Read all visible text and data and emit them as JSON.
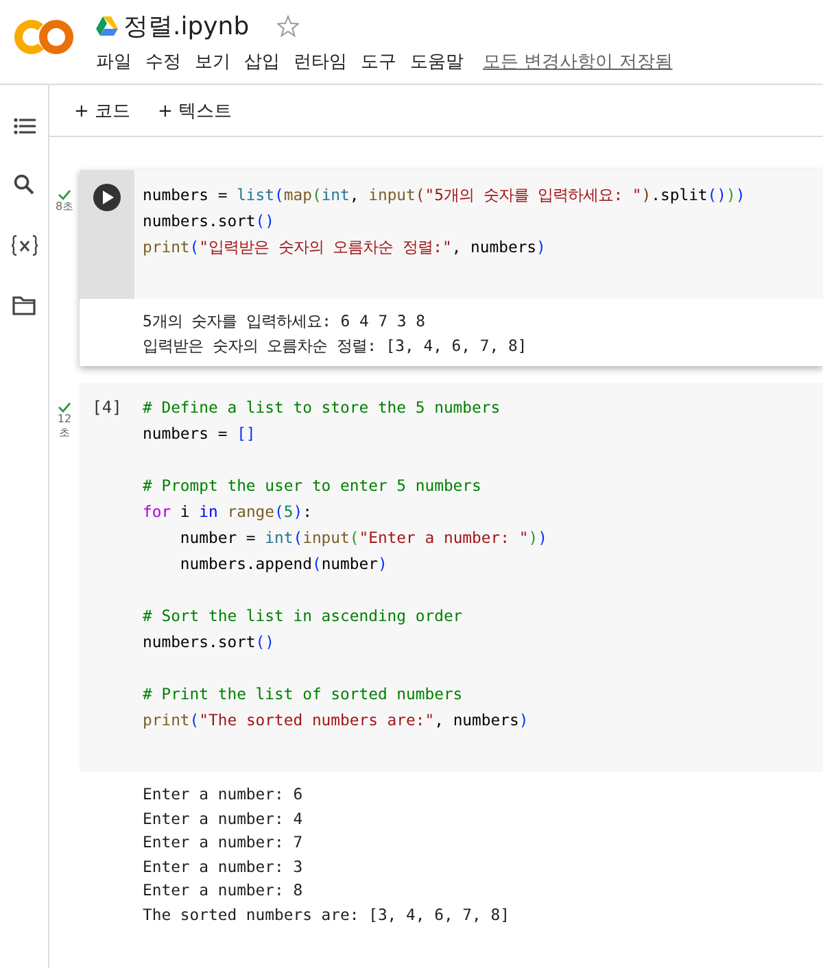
{
  "header": {
    "title": "정렬.ipynb",
    "menu": [
      "파일",
      "수정",
      "보기",
      "삽입",
      "런타임",
      "도구",
      "도움말"
    ],
    "save_status": "모든 변경사항이 저장됨"
  },
  "toolbar": [
    "+ 코드",
    "+ 텍스트"
  ],
  "cells": [
    {
      "focused": true,
      "status": "8초",
      "lines": [
        {
          "kind": "code",
          "tokens": [
            {
              "kind": "plain",
              "text": "numbers = "
            },
            {
              "kind": "builtin",
              "text": "list"
            },
            {
              "kind": "bracket1",
              "text": "("
            },
            {
              "kind": "func",
              "text": "map"
            },
            {
              "kind": "bracket2",
              "text": "("
            },
            {
              "kind": "builtin",
              "text": "int"
            },
            {
              "kind": "plain",
              "text": ", "
            },
            {
              "kind": "func",
              "text": "input"
            },
            {
              "kind": "bracket3",
              "text": "("
            },
            {
              "kind": "string",
              "text": "\"5개의 숫자를 입력하세요: \""
            },
            {
              "kind": "bracket3",
              "text": ")"
            },
            {
              "kind": "plain",
              "text": ".split"
            },
            {
              "kind": "bracket1",
              "text": "()"
            },
            {
              "kind": "bracket2",
              "text": ")"
            },
            {
              "kind": "bracket1",
              "text": ")"
            }
          ]
        },
        {
          "kind": "code",
          "tokens": [
            {
              "kind": "plain",
              "text": "numbers.sort"
            },
            {
              "kind": "bracket1",
              "text": "()"
            }
          ]
        },
        {
          "kind": "code",
          "tokens": [
            {
              "kind": "func",
              "text": "print"
            },
            {
              "kind": "bracket1",
              "text": "("
            },
            {
              "kind": "string",
              "text": "\"입력받은 숫자의 오름차순 정렬:\""
            },
            {
              "kind": "plain",
              "text": ", numbers"
            },
            {
              "kind": "bracket1",
              "text": ")"
            }
          ]
        }
      ],
      "output": [
        "5개의 숫자를 입력하세요: 6 4 7 3 8",
        "입력받은 숫자의 오름차순 정렬: [3, 4, 6, 7, 8]"
      ]
    },
    {
      "focused": false,
      "exec_label": "[4]",
      "status": "12 초",
      "lines": [
        {
          "kind": "code",
          "tokens": [
            {
              "kind": "comment",
              "text": "# Define a list to store the 5 numbers"
            }
          ]
        },
        {
          "kind": "code",
          "tokens": [
            {
              "kind": "plain",
              "text": "numbers = "
            },
            {
              "kind": "bracket1",
              "text": "[]"
            }
          ]
        },
        {
          "kind": "blank"
        },
        {
          "kind": "code",
          "tokens": [
            {
              "kind": "comment",
              "text": "# Prompt the user to enter 5 numbers"
            }
          ]
        },
        {
          "kind": "code",
          "tokens": [
            {
              "kind": "keyword",
              "text": "for"
            },
            {
              "kind": "plain",
              "text": " i "
            },
            {
              "kind": "keyword2",
              "text": "in"
            },
            {
              "kind": "func",
              "text": " range"
            },
            {
              "kind": "bracket1",
              "text": "("
            },
            {
              "kind": "number",
              "text": "5"
            },
            {
              "kind": "bracket1",
              "text": ")"
            },
            {
              "kind": "plain",
              "text": ":"
            }
          ]
        },
        {
          "kind": "code",
          "tokens": [
            {
              "kind": "plain",
              "text": "    number = "
            },
            {
              "kind": "builtin",
              "text": "int"
            },
            {
              "kind": "bracket1",
              "text": "("
            },
            {
              "kind": "func",
              "text": "input"
            },
            {
              "kind": "bracket2",
              "text": "("
            },
            {
              "kind": "string",
              "text": "\"Enter a number: \""
            },
            {
              "kind": "bracket2",
              "text": ")"
            },
            {
              "kind": "bracket1",
              "text": ")"
            }
          ]
        },
        {
          "kind": "code",
          "tokens": [
            {
              "kind": "plain",
              "text": "    numbers.append"
            },
            {
              "kind": "bracket1",
              "text": "("
            },
            {
              "kind": "plain",
              "text": "number"
            },
            {
              "kind": "bracket1",
              "text": ")"
            }
          ]
        },
        {
          "kind": "blank"
        },
        {
          "kind": "code",
          "tokens": [
            {
              "kind": "comment",
              "text": "# Sort the list in ascending order"
            }
          ]
        },
        {
          "kind": "code",
          "tokens": [
            {
              "kind": "plain",
              "text": "numbers.sort"
            },
            {
              "kind": "bracket1",
              "text": "()"
            }
          ]
        },
        {
          "kind": "blank"
        },
        {
          "kind": "code",
          "tokens": [
            {
              "kind": "comment",
              "text": "# Print the list of sorted numbers"
            }
          ]
        },
        {
          "kind": "code",
          "tokens": [
            {
              "kind": "func",
              "text": "print"
            },
            {
              "kind": "bracket1",
              "text": "("
            },
            {
              "kind": "string",
              "text": "\"The sorted numbers are:\""
            },
            {
              "kind": "plain",
              "text": ", numbers"
            },
            {
              "kind": "bracket1",
              "text": ")"
            }
          ]
        }
      ],
      "output": [
        "Enter a number: 6",
        "Enter a number: 4",
        "Enter a number: 7",
        "Enter a number: 3",
        "Enter a number: 8",
        "The sorted numbers are: [3, 4, 6, 7, 8]"
      ]
    }
  ]
}
